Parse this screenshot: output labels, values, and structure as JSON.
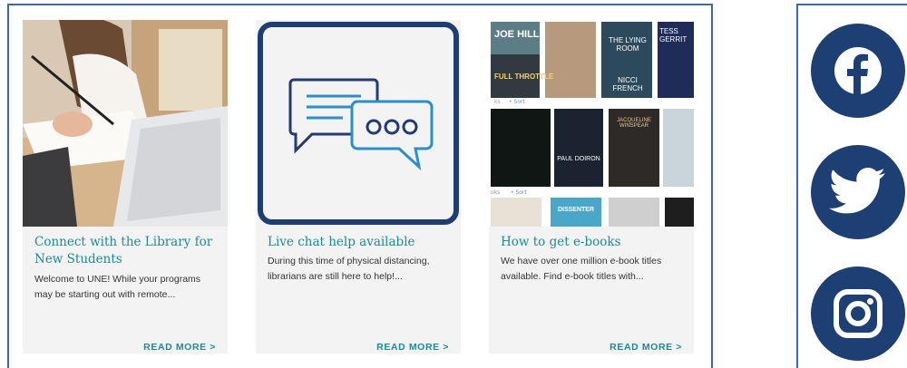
{
  "cards": [
    {
      "title": "Connect with the Library for New Students",
      "excerpt": "Welcome to UNE! While your programs may be starting out with remote...",
      "read_more": "READ MORE >"
    },
    {
      "title": "Live chat help available",
      "excerpt": "During this time of physical distancing, librarians are still here to help!...",
      "read_more": "READ MORE >"
    },
    {
      "title": "How to get e-books",
      "excerpt": "We have over one million e-book titles available. Find e-book titles with...",
      "read_more": "READ MORE >"
    }
  ],
  "book_covers": {
    "row1": [
      "JOE HILL",
      "FULL THROTTLE",
      "THE LYING ROOM",
      "NICCI FRENCH",
      "TESS GERRIT"
    ],
    "row2": [
      "PAUL DOIRON",
      "JACQUELINE WINSPEAR"
    ],
    "row3": [
      "DISSENTER"
    ],
    "labels": [
      "Sort",
      "Sort"
    ]
  },
  "social": [
    "facebook-icon",
    "twitter-icon",
    "instagram-icon"
  ],
  "colors": {
    "accent": "#1c8b95",
    "navy": "#1e3f73",
    "border": "#3d67a8"
  }
}
